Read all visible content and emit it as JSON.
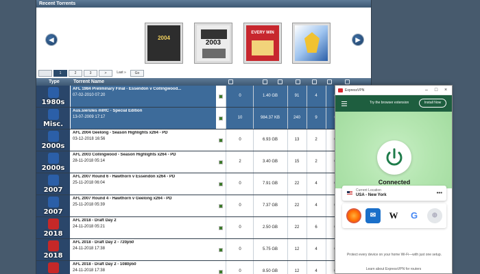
{
  "recent": {
    "title": "Recent Torrents",
    "covers": [
      {
        "text": "2004",
        "bg": "#3a3a3a",
        "fg": "#f4d35e"
      },
      {
        "text": "2003",
        "bg": "#e9e9e9",
        "fg": "#111"
      },
      {
        "text": "EVERY WIN",
        "bg": "#c7272e",
        "fg": "#fff"
      },
      {
        "text": "",
        "bg": "#5b8fd0",
        "fg": "#fff"
      }
    ]
  },
  "pager": {
    "pages": [
      "1",
      "2",
      "3",
      ">"
    ],
    "last": "Last »",
    "go": "Go"
  },
  "table": {
    "headers": {
      "type": "Type",
      "name": "Torrent Name"
    },
    "rows": [
      {
        "year": "1980s",
        "name": "AFL 1984 Preliminary Final - Essendon v Collingwood...",
        "date": "07-02-2010 07:20",
        "n1": "0",
        "size": "1.40 GB",
        "seed": "91",
        "leech": "4",
        "comp": "0",
        "sel": true
      },
      {
        "year": "Misc.",
        "name": "Aus.sierules mIRC - Special Edition",
        "date": "13-07-2009 17:17",
        "n1": "10",
        "size": "984.37 KB",
        "seed": "240",
        "leech": "9",
        "comp": "0",
        "sel": true
      },
      {
        "year": "2000s",
        "name": "AFL 2004 Geelong - Season Highlights x264 - PD",
        "date": "03-12-2018 16:56",
        "n1": "0",
        "size": "6.93 GB",
        "seed": "13",
        "leech": "2",
        "comp": "0",
        "sel": false
      },
      {
        "year": "2000s",
        "name": "AFL 2003 Collingwood - Season Highlights x264 - PD",
        "date": "28-11-2018 05:14",
        "n1": "2",
        "size": "3.40 GB",
        "seed": "15",
        "leech": "2",
        "comp": "0",
        "sel": false
      },
      {
        "year": "2007",
        "name": "AFL 2007 Round 6 - Hawthorn v Essendon x264 - PD",
        "date": "25-11-2018 06:04",
        "n1": "0",
        "size": "7.91 GB",
        "seed": "22",
        "leech": "4",
        "comp": "0",
        "sel": false
      },
      {
        "year": "2007",
        "name": "AFL 2007 Round 4 - Hawthorn v Geelong x264 - PD",
        "date": "25-11-2018 05:39",
        "n1": "0",
        "size": "7.37 GB",
        "seed": "22",
        "leech": "4",
        "comp": "0",
        "sel": false
      },
      {
        "year": "2018",
        "name": "AFL 2018 - Draft Day 2",
        "date": "24-11-2018 05:21",
        "n1": "0",
        "size": "2.50 GB",
        "seed": "22",
        "leech": "6",
        "comp": "0",
        "sel": false
      },
      {
        "year": "2018",
        "name": "AFL 2018 - Draft Day 2 - 720p50",
        "date": "24-11-2018 17:38",
        "n1": "0",
        "size": "5.75 GB",
        "seed": "12",
        "leech": "4",
        "comp": "0",
        "sel": false
      },
      {
        "year": "2018",
        "name": "AFL 2018 - Draft Day 2 - 1080p50",
        "date": "24-11-2018 17:38",
        "n1": "0",
        "size": "8.50 GB",
        "seed": "12",
        "leech": "4",
        "comp": "0",
        "sel": false
      }
    ]
  },
  "vpn": {
    "title": "ExpressVPN",
    "banner": "Try the browser extension",
    "install": "Install Now",
    "status": "Connected",
    "location_label": "Current Location",
    "location": "USA - New York",
    "more": "•••",
    "footer": "Protect every device on your home Wi-Fi—with just one setup.",
    "learn": "Learn about ExpressVPN for routers",
    "colors": {
      "green_dark": "#1e5e3f",
      "accent": "#d8262e"
    }
  }
}
